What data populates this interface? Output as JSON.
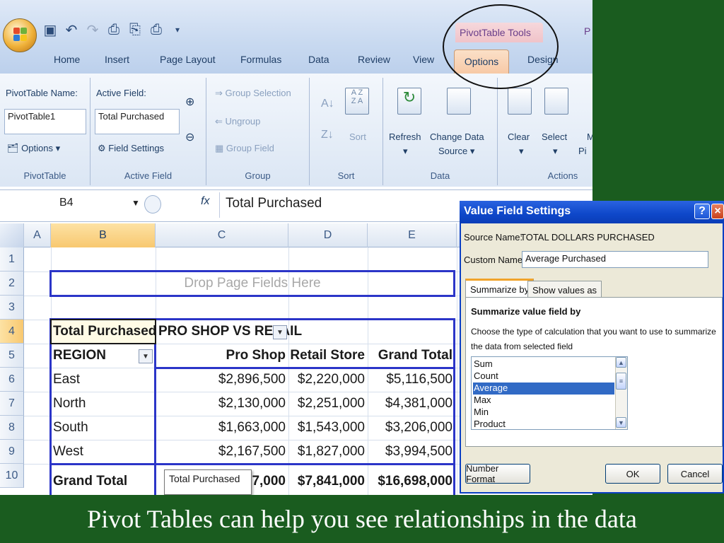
{
  "window": {
    "pivot_tools_label": "PivotTable Tools",
    "pivot_tools_partial": "P",
    "tabs": [
      "Home",
      "Insert",
      "Page Layout",
      "Formulas",
      "Data",
      "Review",
      "View",
      "Options",
      "Design"
    ],
    "active_tab": "Options"
  },
  "ribbon": {
    "pivottable": {
      "name_label": "PivotTable Name:",
      "name_value": "PivotTable1",
      "options_label": "Options",
      "group_label": "PivotTable"
    },
    "active_field": {
      "label": "Active Field:",
      "value": "Total Purchased",
      "settings_label": "Field Settings",
      "group_label": "Active Field"
    },
    "group": {
      "group_selection": "Group Selection",
      "ungroup": "Ungroup",
      "group_field": "Group Field",
      "group_label": "Group"
    },
    "sort": {
      "sort_label": "Sort",
      "group_label": "Sort"
    },
    "data": {
      "refresh": "Refresh",
      "change_data_source_1": "Change Data",
      "change_data_source_2": "Source",
      "group_label": "Data"
    },
    "actions": {
      "clear": "Clear",
      "select": "Select",
      "move_partial": "M",
      "pivot_partial": "Pi",
      "group_label": "Actions"
    }
  },
  "formula_bar": {
    "name_box": "B4",
    "fx_label": "fx",
    "value": "Total Purchased"
  },
  "grid": {
    "columns": [
      "A",
      "B",
      "C",
      "D",
      "E"
    ],
    "rows": [
      "1",
      "2",
      "3",
      "4",
      "5",
      "6",
      "7",
      "8",
      "9",
      "10"
    ],
    "drop_page_fields": "Drop Page Fields Here",
    "data_field": "Total Purchased",
    "column_field": "PRO SHOP VS RETAIL",
    "row_field": "REGION",
    "col_headers": [
      "Pro Shop",
      "Retail Store",
      "Grand Total"
    ],
    "table": [
      {
        "region": "East",
        "pro": "$2,896,500",
        "retail": "$2,220,000",
        "total": "$5,116,500"
      },
      {
        "region": "North",
        "pro": "$2,130,000",
        "retail": "$2,251,000",
        "total": "$4,381,000"
      },
      {
        "region": "South",
        "pro": "$1,663,000",
        "retail": "$1,543,000",
        "total": "$3,206,000"
      },
      {
        "region": "West",
        "pro": "$2,167,500",
        "retail": "$1,827,000",
        "total": "$3,994,500"
      },
      {
        "region": "Grand Total",
        "pro": "7,000",
        "retail": "$7,841,000",
        "total": "$16,698,000"
      }
    ],
    "tooltip": "Total Purchased"
  },
  "dialog": {
    "title": "Value Field Settings",
    "source_label": "Source Name:",
    "source_value": "TOTAL DOLLARS PURCHASED",
    "custom_label": "Custom Name:",
    "custom_value": "Average Purchased",
    "tab_summarize": "Summarize by",
    "tab_show_values": "Show values as",
    "section_title": "Summarize value field by",
    "description_1": "Choose the type of calculation that you want to use to summarize",
    "description_2": "the data from selected field",
    "options": [
      "Sum",
      "Count",
      "Average",
      "Max",
      "Min",
      "Product"
    ],
    "selected_option": "Average",
    "number_format": "Number Format",
    "ok": "OK",
    "cancel": "Cancel"
  },
  "caption": "Pivot Tables can help you see relationships in the data"
}
